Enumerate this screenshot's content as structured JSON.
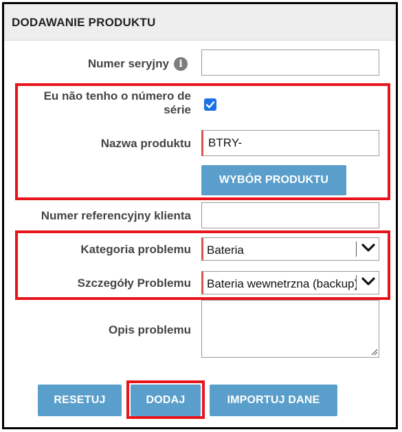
{
  "panel": {
    "title": "DODAWANIE PRODUKTU"
  },
  "form": {
    "serial_number": {
      "label": "Numer seryjny",
      "value": "",
      "info_icon": "info-icon"
    },
    "no_serial": {
      "label": "Eu não tenho o número de série",
      "checked": true
    },
    "product_name": {
      "label": "Nazwa produktu",
      "value": "BTRY-"
    },
    "product_select_button": "WYBÓR PRODUKTU",
    "customer_ref": {
      "label": "Numer referencyjny klienta",
      "value": ""
    },
    "problem_category": {
      "label": "Kategoria problemu",
      "value": "Bateria"
    },
    "problem_details": {
      "label": "Szczegóły Problemu",
      "value": "Bateria wewnetrzna (backup)"
    },
    "problem_description": {
      "label": "Opis problemu",
      "value": ""
    }
  },
  "actions": {
    "reset": "RESETUJ",
    "add": "DODAJ",
    "import": "IMPORTUJ DANE"
  },
  "colors": {
    "accent_button": "#5a9fcb",
    "highlight": "#e8141b",
    "required_mark": "#d9534f"
  }
}
